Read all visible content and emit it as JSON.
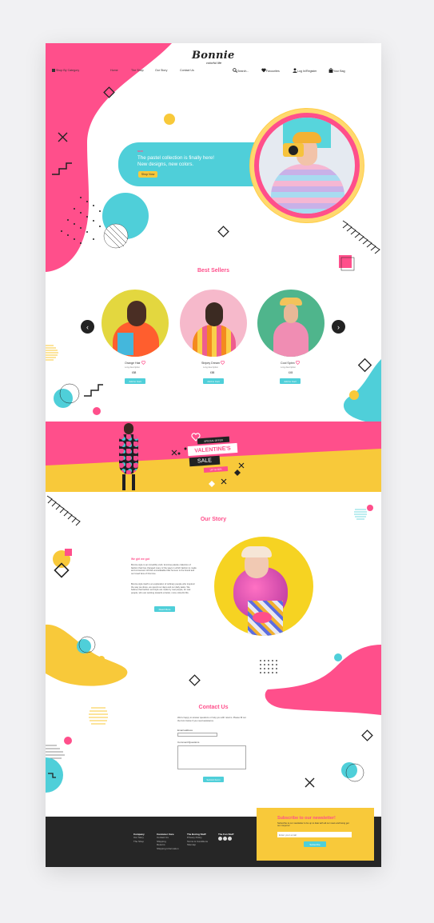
{
  "header": {
    "brand": "Bonnie",
    "tagline": "colorful life",
    "nav": {
      "shop_by_category": "Shop By Category",
      "home": "Home",
      "the_shop": "The Shop",
      "our_story": "Our Story",
      "contact_us": "Contact Us",
      "search": "Search...",
      "favourites": "Favourites",
      "login_register": "Log In/Register",
      "your_bag": "Your Bag"
    }
  },
  "hero": {
    "kicker": "NEW",
    "headline_line1": "The pastel collection is finally here!",
    "headline_line2": "New designs, new colors.",
    "cta": "Shop Now"
  },
  "best_sellers": {
    "title": "Best Sellers",
    "products": [
      {
        "name": "Orange Hair",
        "sub": "Long description",
        "price": "£88",
        "button": "Add to Cart"
      },
      {
        "name": "Stripey Dream",
        "sub": "Long description",
        "price": "£88",
        "button": "Add to Cart"
      },
      {
        "name": "Cool Spinn",
        "sub": "Long description",
        "price": "£45",
        "button": "Add to Cart"
      }
    ],
    "prev_glyph": "‹",
    "next_glyph": "›"
  },
  "promo": {
    "top_tag": "SPECIAL OFFER",
    "line1": "VALENTINE'S",
    "line2": "SALE",
    "bottom_tag": "UP TO 50%"
  },
  "our_story": {
    "title": "Our Story",
    "kicker": "We girl we got",
    "paragraph1": "Bonnie style is an incredibly vivid, feminine palette collection of fashion that has changed many of the ways in which fashion is made and consumed. All that unmistakable little humour is the brand and our loved fans of this time.",
    "paragraph2": "Bonnie style itself is an exploration of ordinary people who inspired the way we dress, we spend our days and our daily tasks. We believe that fashion and style are made by real people, for real people, who are working towards a better, more colourful life.",
    "button": "Read More"
  },
  "contact": {
    "title": "Contact Us",
    "intro": "We're happy to answer questions or help you with returns. Please fill out the form below if you need assistance.",
    "email_label": "Email address",
    "comment_label": "Comment/Questions",
    "button": "Submit Form"
  },
  "footer": {
    "col1": {
      "title": "Company",
      "items": [
        "Our Story",
        "The Shop"
      ]
    },
    "col2": {
      "title": "Customer Care",
      "items": [
        "Contact Us",
        "Shipping",
        "Returns",
        "Shipping Information"
      ]
    },
    "col3": {
      "title": "The Boring Stuff",
      "items": [
        "Privacy Policy",
        "Terms & Conditions",
        "Sitemap"
      ]
    },
    "col4": {
      "title": "The Fun Stuff"
    },
    "newsletter": {
      "title": "Subscribe to our newsletter!",
      "text": "Subscribe to our newsletter to be up to date with all our news and being get our coupons !",
      "placeholder": "Enter your email",
      "button": "Subscribe"
    }
  },
  "colors": {
    "pink": "#ff4f8b",
    "cyan": "#4fcfd9",
    "yellow": "#f8c93a",
    "dark": "#262626"
  }
}
